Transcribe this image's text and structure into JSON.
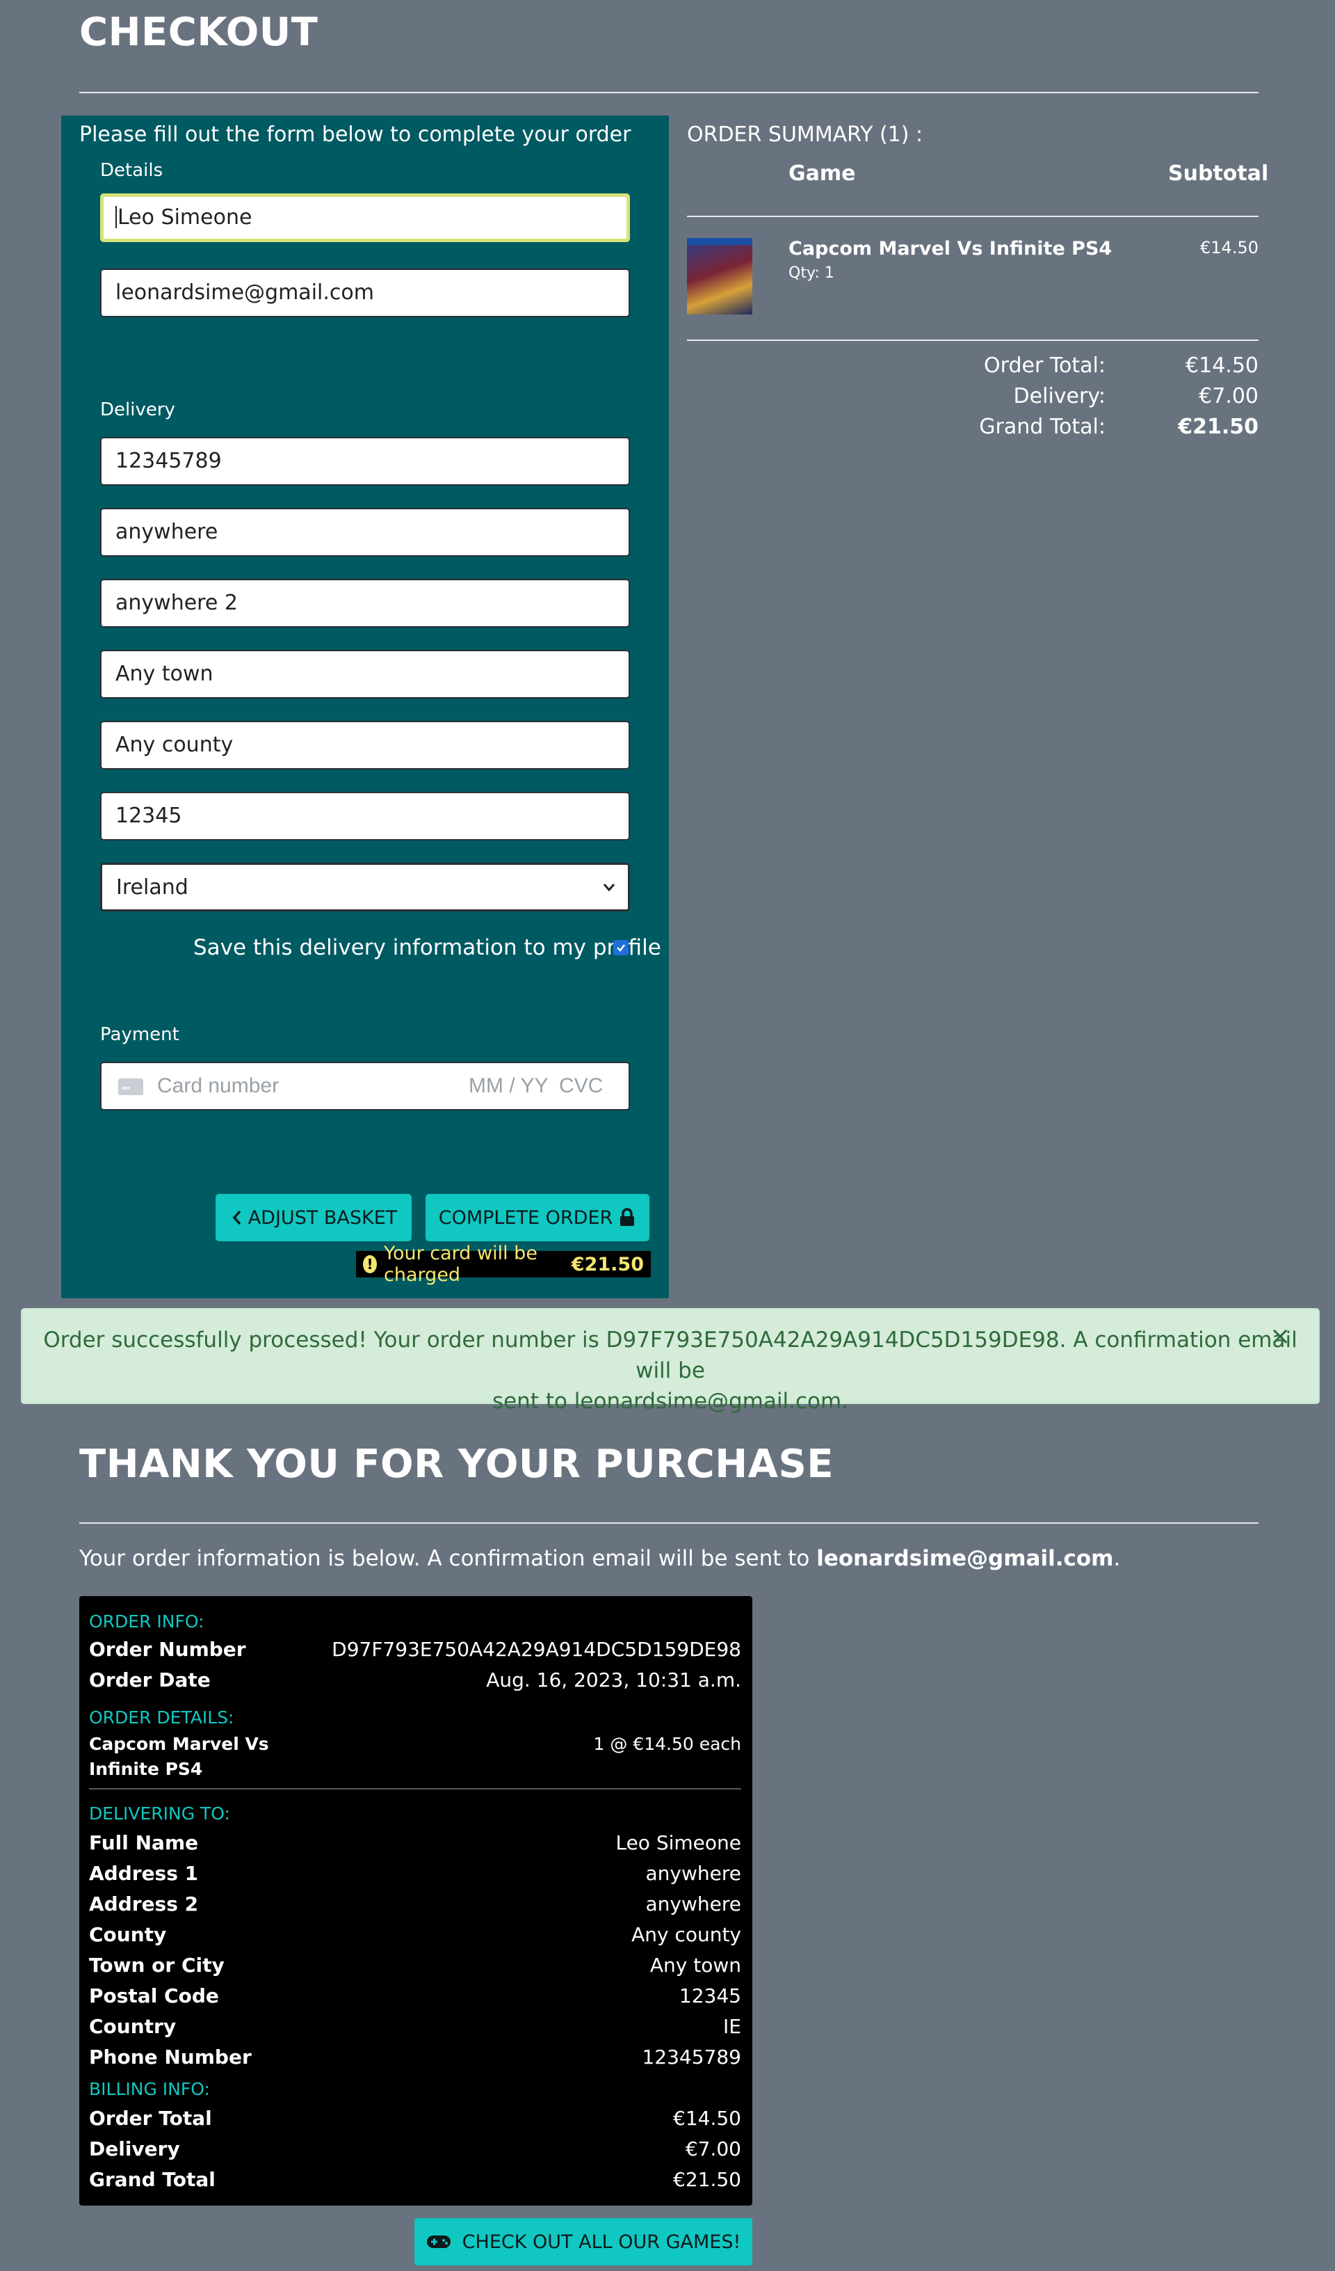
{
  "checkout": {
    "title": "CHECKOUT",
    "intro": "Please fill out the form below to complete your order",
    "details_label": "Details",
    "full_name": "Leo Simeone",
    "email": "leonardsime@gmail.com",
    "delivery_label": "Delivery",
    "phone": "12345789",
    "address1": "anywhere",
    "address2": "anywhere 2",
    "town": "Any town",
    "county": "Any county",
    "postcode": "12345",
    "country": "Ireland",
    "save_info_label": "Save this delivery information to my profile",
    "payment_label": "Payment",
    "card_placeholder": "Card number",
    "expiry_placeholder": "MM / YY",
    "cvc_placeholder": "CVC",
    "adjust_button": "ADJUST BASKET",
    "complete_button": "COMPLETE ORDER",
    "charge_text": "Your card will be charged",
    "charge_amount": "€21.50"
  },
  "summary": {
    "title": "ORDER SUMMARY (1) :",
    "col_game": "Game",
    "col_subtotal": "Subtotal",
    "item_name": "Capcom Marvel Vs Infinite PS4",
    "item_qty": "Qty: 1",
    "item_price": "€14.50",
    "order_total_label": "Order Total:",
    "order_total": "€14.50",
    "delivery_label": "Delivery:",
    "delivery": "€7.00",
    "grand_total_label": "Grand Total:",
    "grand_total": "€21.50"
  },
  "alert": {
    "line1": "Order successfully processed! Your order number is D97F793E750A42A29A914DC5D159DE98. A confirmation email will be",
    "line2": "sent to leonardsime@gmail.com.",
    "close": "×"
  },
  "thanks": {
    "title": "THANK YOU FOR YOUR PURCHASE",
    "info_prefix": "Your order information is below. A confirmation email will be sent to ",
    "info_email": "leonardsime@gmail.com",
    "info_suffix": "."
  },
  "receipt": {
    "order_info_head": "ORDER INFO:",
    "order_number_label": "Order Number",
    "order_number": "D97F793E750A42A29A914DC5D159DE98",
    "order_date_label": "Order Date",
    "order_date": "Aug. 16, 2023, 10:31 a.m.",
    "order_details_head": "ORDER DETAILS:",
    "item_line1": "Capcom Marvel Vs",
    "item_line2": "Infinite PS4",
    "item_qty_price": "1 @ €14.50 each",
    "delivering_head": "DELIVERING TO:",
    "full_name_label": "Full Name",
    "full_name": "Leo Simeone",
    "address1_label": "Address 1",
    "address1": "anywhere",
    "address2_label": "Address 2",
    "address2": "anywhere",
    "county_label": "County",
    "county": "Any county",
    "town_label": "Town or City",
    "town": "Any town",
    "postcode_label": "Postal Code",
    "postcode": "12345",
    "country_label": "Country",
    "country": "IE",
    "phone_label": "Phone Number",
    "phone": "12345789",
    "billing_head": "BILLING INFO:",
    "order_total_label": "Order Total",
    "order_total": "€14.50",
    "delivery_label": "Delivery",
    "delivery": "€7.00",
    "grand_total_label": "Grand Total",
    "grand_total": "€21.50"
  },
  "games_button": "CHECK OUT ALL OUR GAMES!",
  "colors": {
    "page_bg": "#69737f",
    "form_bg": "#005a62",
    "accent": "#10c7c1",
    "alert_bg": "#d4ecd9",
    "charge_text": "#f4e66f"
  },
  "icons": [
    "chevron-left-icon",
    "lock-icon",
    "warning-icon",
    "card-icon",
    "close-icon",
    "gamepad-icon",
    "check-icon",
    "chevron-down-icon"
  ]
}
